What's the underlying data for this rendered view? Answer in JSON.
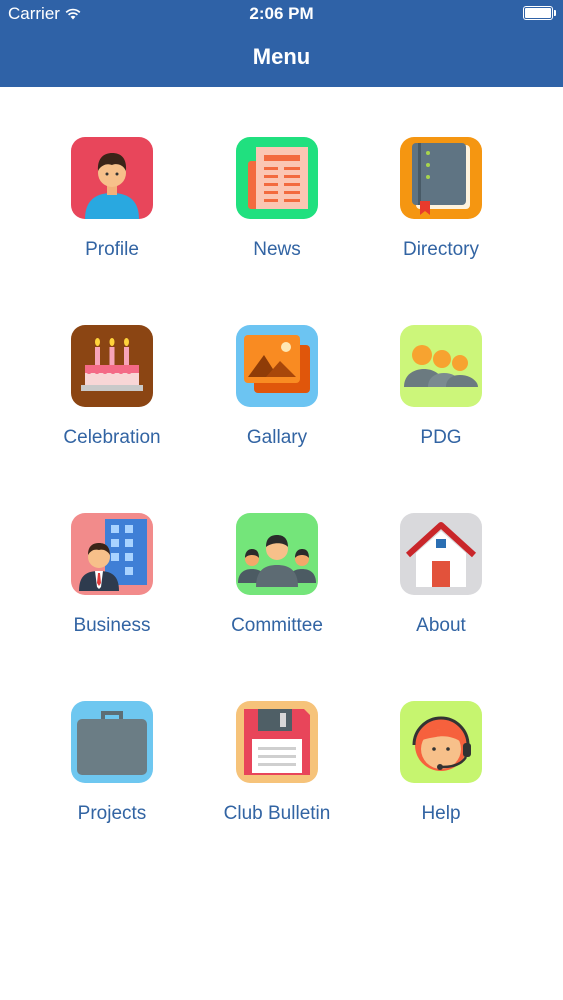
{
  "status_bar": {
    "carrier": "Carrier",
    "time": "2:06 PM"
  },
  "header": {
    "title": "Menu"
  },
  "menu": [
    {
      "label": "Profile",
      "icon": "profile-icon",
      "bg": "#e8465b"
    },
    {
      "label": "News",
      "icon": "news-icon",
      "bg": "#20e07f"
    },
    {
      "label": "Directory",
      "icon": "directory-icon",
      "bg": "#f59611"
    },
    {
      "label": "Celebration",
      "icon": "cake-icon",
      "bg": "#8b4513"
    },
    {
      "label": "Gallary",
      "icon": "gallery-icon",
      "bg": "#6cc4f2"
    },
    {
      "label": "PDG",
      "icon": "group-icon",
      "bg": "#ccf67a"
    },
    {
      "label": "Business",
      "icon": "businessman-icon",
      "bg": "#f28b8b"
    },
    {
      "label": "Committee",
      "icon": "committee-icon",
      "bg": "#74e57a"
    },
    {
      "label": "About",
      "icon": "house-icon",
      "bg": "#d9d9dc"
    },
    {
      "label": "Projects",
      "icon": "briefcase-icon",
      "bg": "#6ec7f0"
    },
    {
      "label": "Club Bulletin",
      "icon": "floppy-disk-icon",
      "bg": "#f6c37a"
    },
    {
      "label": "Help",
      "icon": "support-agent-icon",
      "bg": "#c6f56f"
    }
  ]
}
